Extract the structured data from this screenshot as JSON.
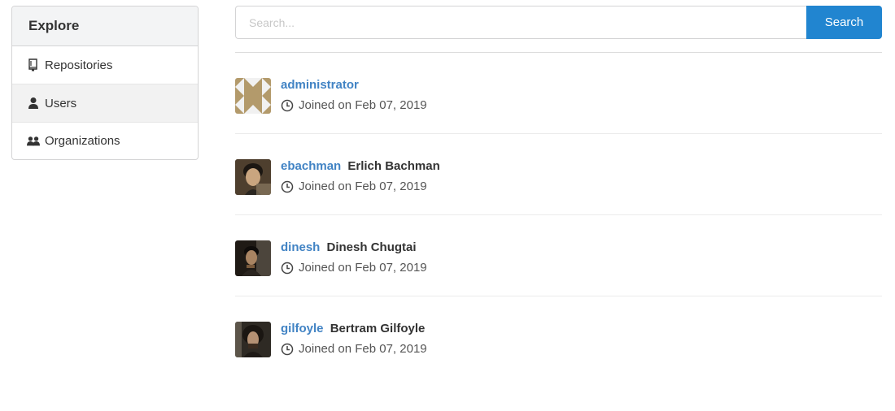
{
  "sidebar": {
    "header": "Explore",
    "items": [
      {
        "label": "Repositories",
        "icon": "repo-icon",
        "active": false
      },
      {
        "label": "Users",
        "icon": "person-icon",
        "active": true
      },
      {
        "label": "Organizations",
        "icon": "organization-icon",
        "active": false
      }
    ]
  },
  "search": {
    "placeholder": "Search...",
    "value": "",
    "button_label": "Search"
  },
  "users": [
    {
      "username": "administrator",
      "full_name": "",
      "joined": "Joined on Feb 07, 2019"
    },
    {
      "username": "ebachman",
      "full_name": "Erlich Bachman",
      "joined": "Joined on Feb 07, 2019"
    },
    {
      "username": "dinesh",
      "full_name": "Dinesh Chugtai",
      "joined": "Joined on Feb 07, 2019"
    },
    {
      "username": "gilfoyle",
      "full_name": "Bertram Gilfoyle",
      "joined": "Joined on Feb 07, 2019"
    }
  ],
  "colors": {
    "accent": "#2185d0",
    "link": "#4183c4",
    "identicon": "#b39a6b"
  }
}
